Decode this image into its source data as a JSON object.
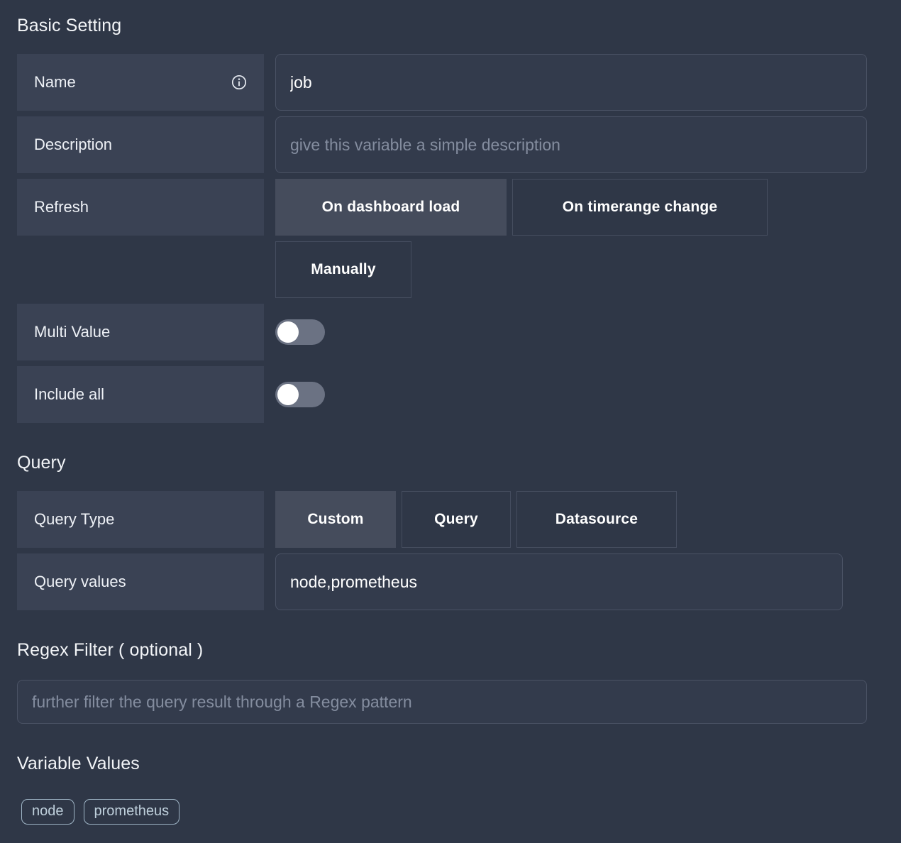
{
  "sections": {
    "basic_setting": "Basic Setting",
    "query": "Query",
    "regex_filter": "Regex Filter ( optional )",
    "variable_values": "Variable Values"
  },
  "basic": {
    "name": {
      "label": "Name",
      "value": "job",
      "info_icon": "info-icon"
    },
    "description": {
      "label": "Description",
      "value": "",
      "placeholder": "give this variable a simple description"
    },
    "refresh": {
      "label": "Refresh",
      "options": [
        {
          "label": "On dashboard load",
          "selected": true
        },
        {
          "label": "On timerange change",
          "selected": false
        },
        {
          "label": "Manually",
          "selected": false
        }
      ]
    },
    "multi_value": {
      "label": "Multi Value",
      "enabled": false
    },
    "include_all": {
      "label": "Include all",
      "enabled": false
    }
  },
  "query": {
    "query_type": {
      "label": "Query Type",
      "options": [
        {
          "label": "Custom",
          "selected": true
        },
        {
          "label": "Query",
          "selected": false
        },
        {
          "label": "Datasource",
          "selected": false
        }
      ]
    },
    "query_values": {
      "label": "Query values",
      "value": "node,prometheus"
    }
  },
  "regex": {
    "value": "",
    "placeholder": "further filter the query result through a Regex pattern"
  },
  "variable_values": {
    "chips": [
      "node",
      "prometheus"
    ]
  },
  "colors": {
    "page_background": "#2f3747",
    "label_cell": "#3a4254",
    "input_background": "#333b4c",
    "input_border": "#4a5264",
    "selected_button": "#454c5c",
    "button_border": "#454d5f",
    "placeholder_text": "#848d9f",
    "chip_border": "#9fb5c6",
    "chip_text": "#bfd0dc",
    "toggle_track": "#6b7283",
    "toggle_knob": "#ffffff",
    "text_primary": "#eef1f6"
  }
}
